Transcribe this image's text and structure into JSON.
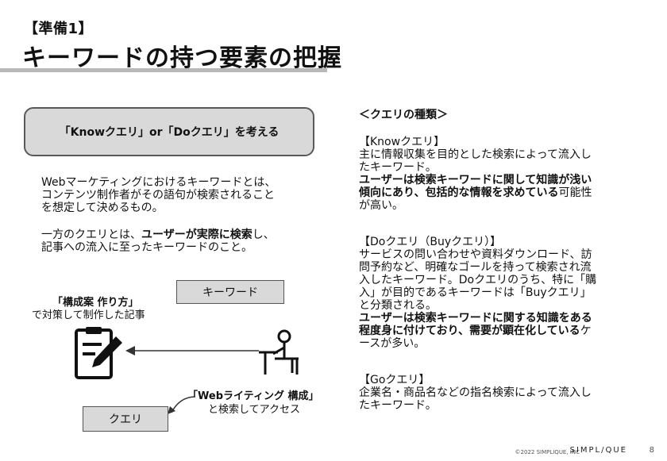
{
  "header": {
    "subtitle": "【準備1】",
    "title": "キーワードの持つ要素の把握"
  },
  "left": {
    "callout": "「Knowクエリ」or「Doクエリ」を考える",
    "para1_a": "Webマーケティングにおけるキーワードとは、\nコンテンツ制作者がその語句が検索されること\nを想定して決めるもの。",
    "para2_a": "一方のクエリとは、",
    "para2_b": "ユーザーが実際に検索",
    "para2_c": "し、\n記事への流入に至ったキーワードのこと。"
  },
  "diagram": {
    "keyword_box": "キーワード",
    "article_label_bold": "「構成案 作り方」",
    "article_label": "で対策して制作した記事",
    "search_label_bold": "「Webライティング 構成」",
    "search_label": "と検索してアクセス",
    "query_box": "クエリ",
    "article_icon": "clipboard-pen-icon",
    "user_icon": "person-at-desk-icon"
  },
  "right": {
    "heading": "＜クエリの種類＞",
    "know_title": "【Knowクエリ】",
    "know_body": "主に情報収集を目的とした検索によって流入し\nたキーワード。",
    "know_bold": "ユーザーは検索キーワードに関して知識が浅い\n傾向にあり、包括的な情報を求めている",
    "know_tail": "可能性\nが高い。",
    "do_title": "【Doクエリ（Buyクエリ）】",
    "do_body": "サービスの問い合わせや資料ダウンロード、訪\n問予約など、明確なゴールを持って検索され流\n入したキーワード。Doクエリのうち、特に「購\n入」が目的であるキーワードは「Buyクエリ」\nと分類される。",
    "do_bold": "ユーザーは検索キーワードに関する知識をある\n程度身に付けており、需要が顕在化している",
    "do_tail": "ケ\nースが多い。",
    "go_title": "【Goクエリ】",
    "go_body": "企業名・商品名などの指名検索によって流入し\nたキーワード。"
  },
  "footer": {
    "copyright": "©2022 SIMPLIQUE, INC",
    "logo": "SIMPL/QUE",
    "page": "8"
  },
  "colors": {
    "box_fill": "#d9d9d9",
    "rule": "#b8b8b8"
  }
}
